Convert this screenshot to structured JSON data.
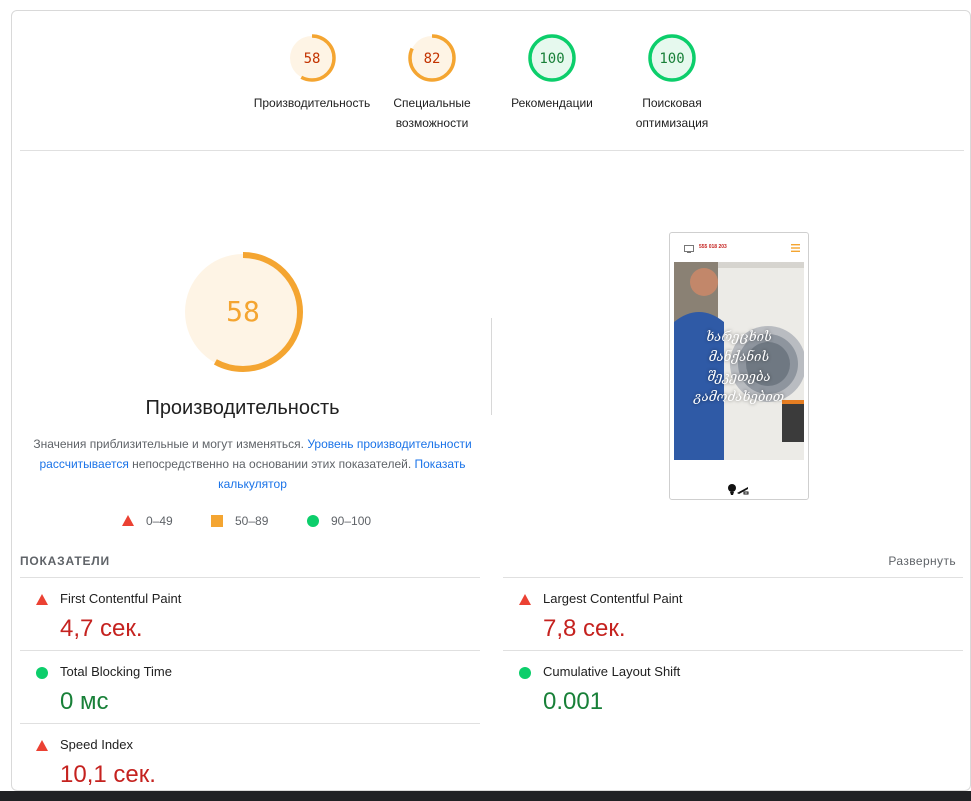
{
  "colors": {
    "fail": "#c5221f",
    "average": "#f4a531",
    "average_text": "#c33300",
    "pass": "#0cce6b",
    "pass_text": "#188038",
    "link": "#1a73e8"
  },
  "top_gauges": [
    {
      "score": "58",
      "label_line1": "Производительность",
      "label_line2": "",
      "rating": "average",
      "fraction": 0.58
    },
    {
      "score": "82",
      "label_line1": "Специальные",
      "label_line2": "возможности",
      "rating": "average",
      "fraction": 0.82
    },
    {
      "score": "100",
      "label_line1": "Рекомендации",
      "label_line2": "",
      "rating": "pass",
      "fraction": 1.0
    },
    {
      "score": "100",
      "label_line1": "Поисковая",
      "label_line2": "оптимизация",
      "rating": "pass",
      "fraction": 1.0
    }
  ],
  "main": {
    "score": "58",
    "score_fraction": 0.58,
    "title": "Производительность",
    "desc_part1": "Значения приблизительные и могут изменяться. ",
    "desc_link1": "Уровень производительности рассчитывается",
    "desc_part2": " непосредственно на основании этих показателей. ",
    "desc_link2": "Показать калькулятор"
  },
  "legend": {
    "fail_range": "0–49",
    "average_range": "50–89",
    "pass_range": "90–100"
  },
  "metrics": {
    "section_title": "ПОКАЗАТЕЛИ",
    "expand_label": "Развернуть",
    "items": [
      {
        "name": "First Contentful Paint",
        "value": "4,7 сек.",
        "rating": "fail"
      },
      {
        "name": "Largest Contentful Paint",
        "value": "7,8 сек.",
        "rating": "fail"
      },
      {
        "name": "Total Blocking Time",
        "value": "0 мс",
        "rating": "pass"
      },
      {
        "name": "Cumulative Layout Shift",
        "value": "0.001",
        "rating": "pass"
      },
      {
        "name": "Speed Index",
        "value": "10,1 сек.",
        "rating": "fail"
      }
    ]
  },
  "screenshot": {
    "phone_number": "555 018 203",
    "hero_text_line1": "ხარეცხის მანქანის",
    "hero_text_line2": "შეკეთება",
    "hero_text_line3": "გამოძახებით"
  }
}
